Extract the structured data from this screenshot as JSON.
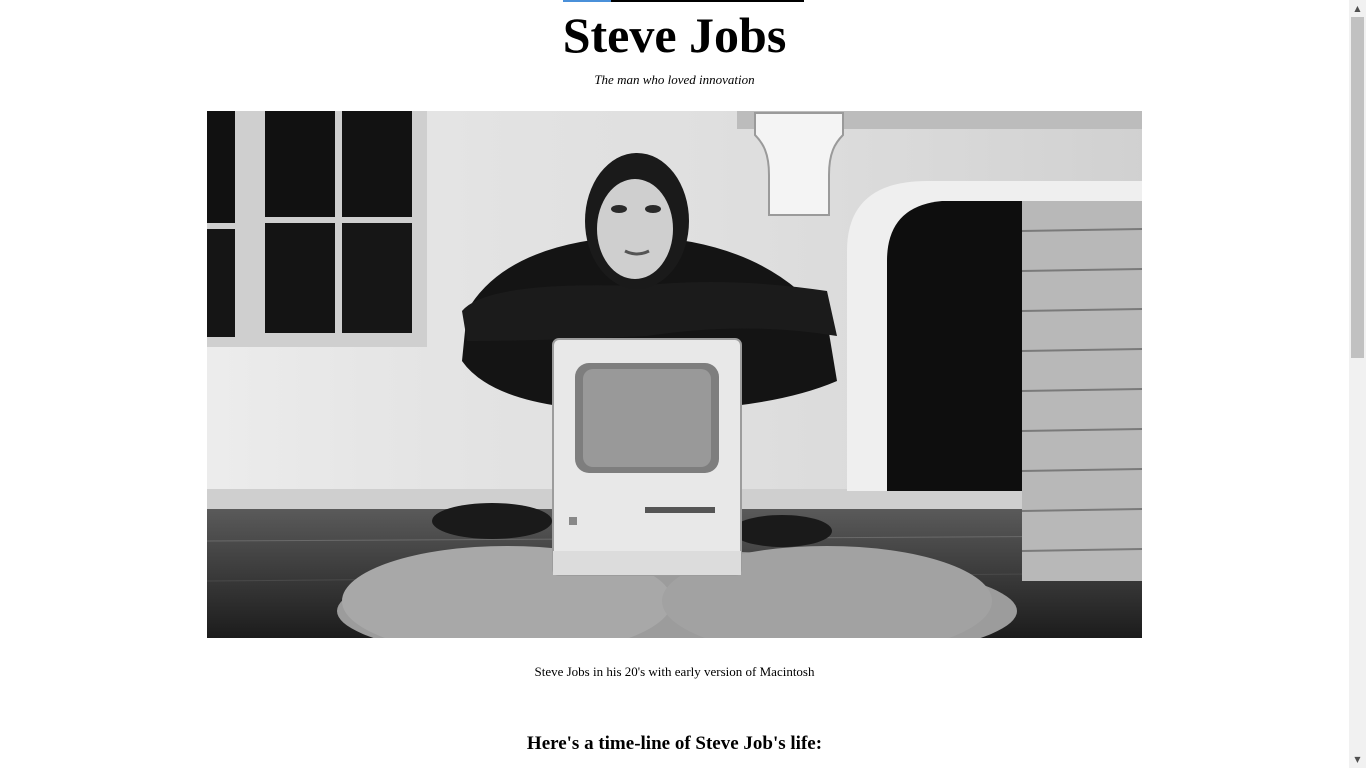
{
  "header": {
    "title": "Steve Jobs",
    "tagline": "The man who loved innovation"
  },
  "figure": {
    "caption": "Steve Jobs in his 20's with early version of Macintosh"
  },
  "timeline": {
    "heading": "Here's a time-line of Steve Job's life:"
  },
  "colors": {
    "background": "#ffffff",
    "text": "#000000",
    "accent": "#4a90d9"
  }
}
